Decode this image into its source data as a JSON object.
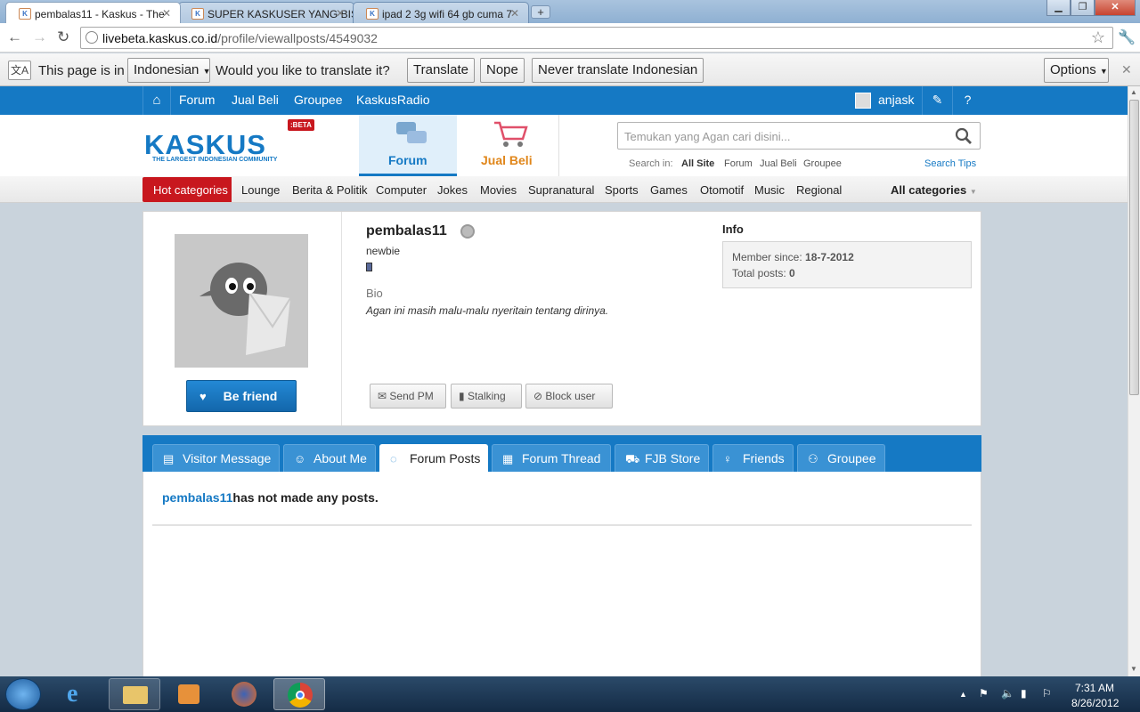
{
  "browser": {
    "tabs": [
      {
        "title": "pembalas11 - Kaskus - The",
        "active": true
      },
      {
        "title": "SUPER KASKUSER YANG BIS",
        "active": false
      },
      {
        "title": "ipad 2 3g wifi 64 gb cuma 7",
        "active": false
      }
    ],
    "url_host": "livebeta.kaskus.co.id",
    "url_path": "/profile/viewallposts/4549032"
  },
  "translate_bar": {
    "prefix": "This page is in",
    "language": "Indonesian",
    "question": "Would you like to translate it?",
    "translate": "Translate",
    "nope": "Nope",
    "never": "Never translate Indonesian",
    "options": "Options"
  },
  "topnav": {
    "items": [
      "Forum",
      "Jual Beli",
      "Groupee",
      "KaskusRadio"
    ],
    "username": "anjask"
  },
  "header": {
    "logo_text": "KASKUS",
    "logo_tagline": "THE LARGEST INDONESIAN COMMUNITY",
    "beta": ":BETA",
    "forum_label": "Forum",
    "jualbeli_label": "Jual Beli",
    "search_placeholder": "Temukan yang Agan cari disini...",
    "search_in_label": "Search in:",
    "search_scopes": [
      "All Site",
      "Forum",
      "Jual Beli",
      "Groupee"
    ],
    "search_tips": "Search Tips"
  },
  "categories": {
    "hot": "Hot categories",
    "items": [
      "Lounge",
      "Berita & Politik",
      "Computer",
      "Jokes",
      "Movies",
      "Supranatural",
      "Sports",
      "Games",
      "Otomotif",
      "Music",
      "Regional"
    ],
    "all": "All categories"
  },
  "profile": {
    "username": "pembalas11",
    "rank": "newbie",
    "bio_label": "Bio",
    "bio": "Agan ini masih malu-malu nyeritain tentang dirinya.",
    "be_friend": "Be friend",
    "actions": [
      "Send PM",
      "Stalking",
      "Block user"
    ],
    "info_title": "Info",
    "member_since_label": "Member since:",
    "member_since": "18-7-2012",
    "total_posts_label": "Total posts:",
    "total_posts": "0"
  },
  "profile_tabs": [
    {
      "label": "Visitor Message",
      "icon": "message-icon",
      "active": false
    },
    {
      "label": "About Me",
      "icon": "user-icon",
      "active": false
    },
    {
      "label": "Forum Posts",
      "icon": "chat-bubble-icon",
      "active": true
    },
    {
      "label": "Forum Thread",
      "icon": "calendar-icon",
      "active": false
    },
    {
      "label": "FJB Store",
      "icon": "cart-icon",
      "active": false
    },
    {
      "label": "Friends",
      "icon": "friend-icon",
      "active": false
    },
    {
      "label": "Groupee",
      "icon": "group-icon",
      "active": false
    }
  ],
  "content": {
    "username_link": "pembalas11",
    "no_posts": "has not made any posts."
  },
  "taskbar": {
    "time": "7:31 AM",
    "date": "8/26/2012"
  },
  "colors": {
    "kaskus_blue": "#1579c4",
    "hot_red": "#c8171e",
    "jualbeli_orange": "#e0861a"
  }
}
